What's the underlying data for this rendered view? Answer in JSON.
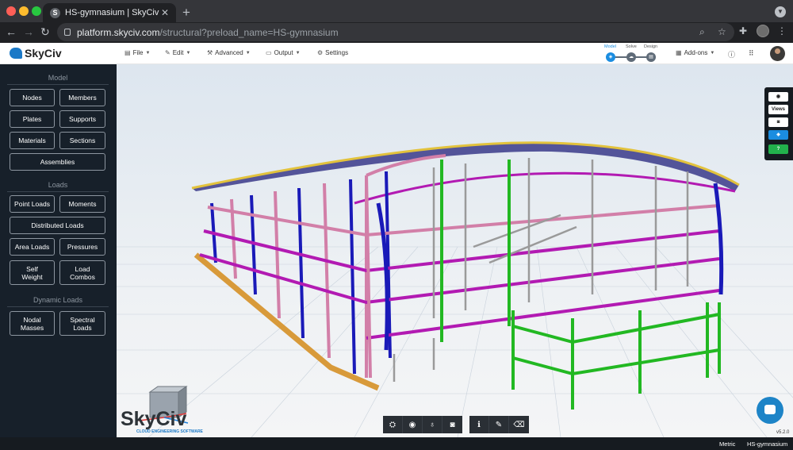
{
  "browser": {
    "tab_title": "HS-gymnasium | SkyCiv",
    "favicon": "S",
    "url_host": "platform.skyciv.com",
    "url_path": "/structural?preload_name=HS-gymnasium"
  },
  "appbar": {
    "brand": "SkyCiv",
    "menus": [
      "File",
      "Edit",
      "Advanced",
      "Output",
      "Settings"
    ],
    "steps": [
      "Model",
      "Solve",
      "Design"
    ],
    "addons": "Add-ons"
  },
  "sidebar": {
    "model_title": "Model",
    "model_buttons": [
      "Nodes",
      "Members",
      "Plates",
      "Supports",
      "Materials",
      "Sections",
      "Assemblies"
    ],
    "loads_title": "Loads",
    "loads_buttons": [
      "Point Loads",
      "Moments",
      "Distributed Loads",
      "Area Loads",
      "Pressures",
      "Self Weight",
      "Load Combos"
    ],
    "dynamic_title": "Dynamic Loads",
    "dynamic_buttons": [
      "Nodal Masses",
      "Spectral Loads"
    ]
  },
  "right_panel": {
    "views_label": "Views"
  },
  "watermark": {
    "brand": "SkyCiv",
    "tagline": "CLOUD ENGINEERING SOFTWARE"
  },
  "version": "v5.2.0",
  "status": {
    "units": "Metric",
    "file": "HS-gymnasium"
  },
  "colors": {
    "sidebar": "#17202a",
    "accent": "#1b8de0",
    "member_blue": "#1a1ab8",
    "member_magenta": "#b21ab2",
    "member_pink": "#d27fa8",
    "member_green": "#22b822",
    "member_orange": "#d89a3a",
    "member_gray": "#9a9a9a"
  }
}
